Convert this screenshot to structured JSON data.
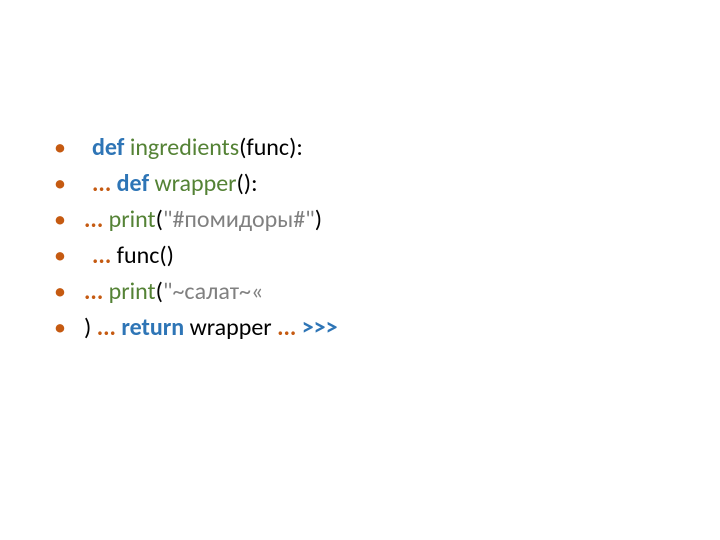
{
  "lines": [
    {
      "leading_space": true,
      "parts": [
        {
          "cls": "kw",
          "t": "def "
        },
        {
          "cls": "fn",
          "t": "ingredients"
        },
        {
          "cls": "",
          "t": "(func):"
        }
      ]
    },
    {
      "leading_space": true,
      "parts": [
        {
          "cls": "dots",
          "t": "... "
        },
        {
          "cls": "kw",
          "t": "def "
        },
        {
          "cls": "fn",
          "t": "wrapper"
        },
        {
          "cls": "",
          "t": "():"
        }
      ]
    },
    {
      "leading_space": false,
      "parts": [
        {
          "cls": "dots",
          "t": "... "
        },
        {
          "cls": "fn",
          "t": "print"
        },
        {
          "cls": "",
          "t": "("
        },
        {
          "cls": "str",
          "t": "\"#помидоры#\""
        },
        {
          "cls": "",
          "t": ")"
        }
      ]
    },
    {
      "leading_space": true,
      "parts": [
        {
          "cls": "dots",
          "t": "... "
        },
        {
          "cls": "",
          "t": "func()"
        }
      ]
    },
    {
      "leading_space": false,
      "parts": [
        {
          "cls": "dots",
          "t": "... "
        },
        {
          "cls": "fn",
          "t": "print"
        },
        {
          "cls": "",
          "t": "("
        },
        {
          "cls": "str",
          "t": "\"~салат~«"
        }
      ]
    },
    {
      "leading_space": false,
      "parts": [
        {
          "cls": "",
          "t": ") "
        },
        {
          "cls": "dots",
          "t": "... "
        },
        {
          "cls": "kw",
          "t": "return "
        },
        {
          "cls": "",
          "t": "wrapper "
        },
        {
          "cls": "dots",
          "t": "... "
        },
        {
          "cls": "prompt",
          "t": ">>>"
        }
      ]
    }
  ]
}
